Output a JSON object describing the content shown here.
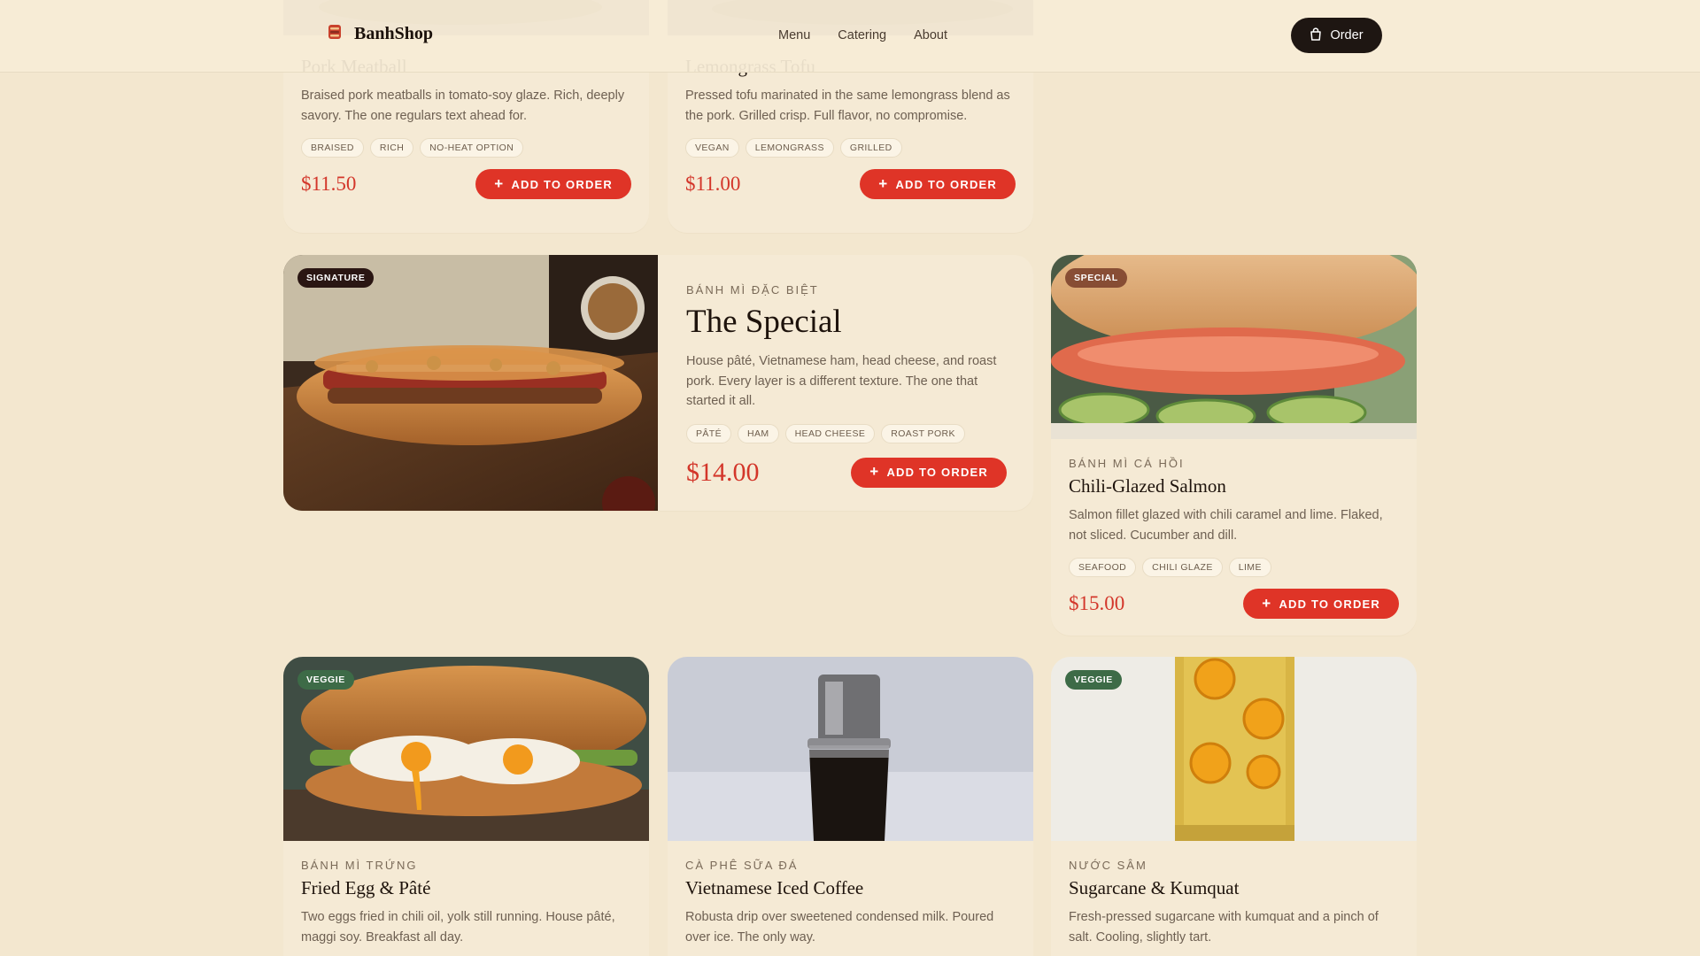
{
  "header": {
    "brand": "BanhShop",
    "nav": [
      "Menu",
      "Catering",
      "About"
    ],
    "order_label": "Order"
  },
  "add_label": "ADD TO ORDER",
  "accent_color": "#df3427",
  "cards": {
    "pork": {
      "title": "Pork Meatball",
      "description": "Braised pork meatballs in tomato-soy glaze. Rich, deeply savory. The one regulars text ahead for.",
      "tags": [
        "BRAISED",
        "RICH",
        "NO-HEAT OPTION"
      ],
      "price": "$11.50"
    },
    "tofu": {
      "title": "Lemongrass Tofu",
      "description": "Pressed tofu marinated in the same lemongrass blend as the pork. Grilled crisp. Full flavor, no compromise.",
      "tags": [
        "VEGAN",
        "LEMONGRASS",
        "GRILLED"
      ],
      "price": "$11.00"
    },
    "special": {
      "badge": "SIGNATURE",
      "eyebrow": "BÁNH MÌ ĐẶC BIỆT",
      "title": "The Special",
      "description": "House pâté, Vietnamese ham, head cheese, and roast pork. Every layer is a different texture. The one that started it all.",
      "tags": [
        "PÂTÉ",
        "HAM",
        "HEAD CHEESE",
        "ROAST PORK"
      ],
      "price": "$14.00"
    },
    "salmon": {
      "badge": "SPECIAL",
      "eyebrow": "BÁNH MÌ CÁ HỒI",
      "title": "Chili-Glazed Salmon",
      "description": "Salmon fillet glazed with chili caramel and lime. Flaked, not sliced. Cucumber and dill.",
      "tags": [
        "SEAFOOD",
        "CHILI GLAZE",
        "LIME"
      ],
      "price": "$15.00"
    },
    "egg": {
      "badge": "VEGGIE",
      "eyebrow": "BÁNH MÌ TRỨNG",
      "title": "Fried Egg & Pâté",
      "description": "Two eggs fried in chili oil, yolk still running. House pâté, maggi soy. Breakfast all day."
    },
    "coffee": {
      "eyebrow": "CÀ PHÊ SỮA ĐÁ",
      "title": "Vietnamese Iced Coffee",
      "description": "Robusta drip over sweetened condensed milk. Poured over ice. The only way."
    },
    "sugarcane": {
      "badge": "VEGGIE",
      "eyebrow": "NƯỚC SÂM",
      "title": "Sugarcane & Kumquat",
      "description": "Fresh-pressed sugarcane with kumquat and a pinch of salt. Cooling, slightly tart."
    }
  }
}
